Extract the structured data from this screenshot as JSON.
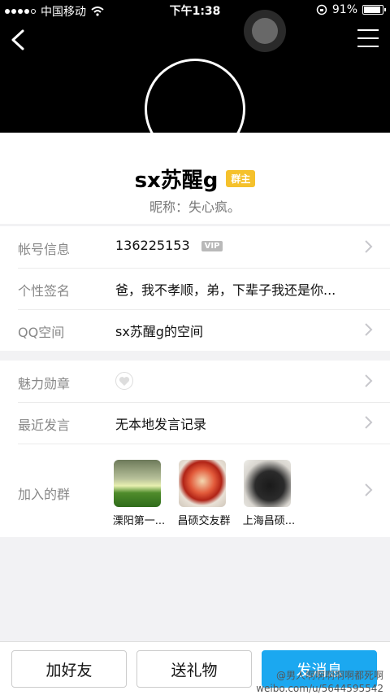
{
  "status_bar": {
    "carrier": "中国移动",
    "time": "下午1:38",
    "battery": "91%",
    "battery_level": 0.91
  },
  "profile": {
    "name": "sx苏醒g",
    "role_badge": "群主",
    "nickname": "昵称：失心疯。"
  },
  "info": {
    "account_label": "帐号信息",
    "account_value": "136225153",
    "vip_badge": "VIP",
    "signature_label": "个性签名",
    "signature_value": "爸，我不孝顺，弟，下辈子我还是你...",
    "qzone_label": "QQ空间",
    "qzone_value": "sx苏醒g的空间"
  },
  "more": {
    "medal_label": "魅力勋章",
    "recent_label": "最近发言",
    "recent_value": "无本地发言记录",
    "groups_label": "加入的群",
    "groups": [
      {
        "name": "溧阳第一..."
      },
      {
        "name": "昌硕交友群"
      },
      {
        "name": "上海昌硕..."
      }
    ]
  },
  "actions": {
    "add_friend": "加好友",
    "send_gift": "送礼物",
    "send_message": "发消息"
  },
  "watermark": {
    "line1": "@男人啊啊啊啊啊都死啊",
    "line2": "weibo.com/u/5644595542"
  },
  "colors": {
    "accent": "#1ba8f0",
    "badge": "#f5c12c",
    "header": "#000000"
  },
  "icons": {
    "back": "chevron-left-icon",
    "menu": "menu-icon",
    "wifi": "wifi-icon",
    "chevron": "chevron-right-icon",
    "medal": "heart-medal-icon"
  }
}
